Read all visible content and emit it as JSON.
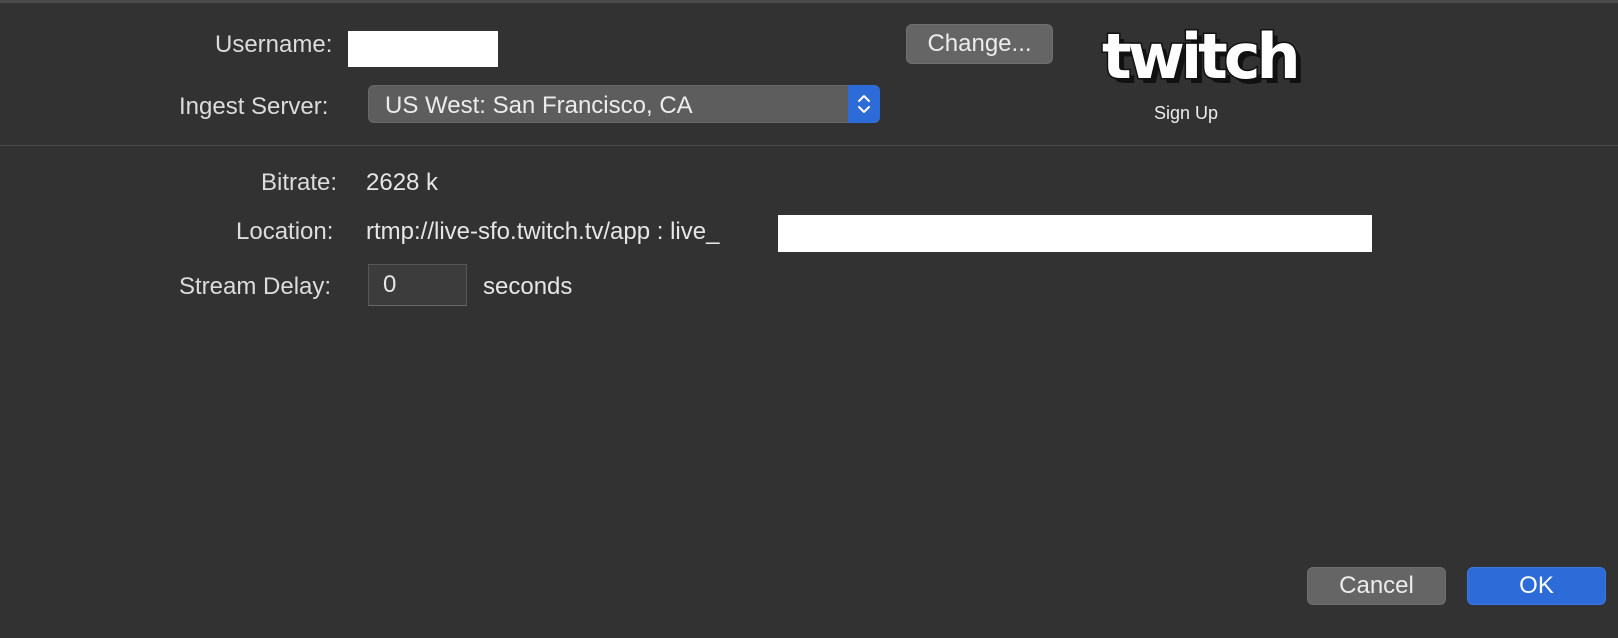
{
  "account": {
    "username_label": "Username:",
    "change_button": "Change...",
    "ingest_label": "Ingest Server:",
    "ingest_value": "US West: San Francisco, CA",
    "logo_text": "twitch",
    "signup_link": "Sign Up"
  },
  "stream": {
    "bitrate_label": "Bitrate:",
    "bitrate_value": "2628 k",
    "location_label": "Location:",
    "location_value": "rtmp://live-sfo.twitch.tv/app : live_",
    "delay_label": "Stream Delay:",
    "delay_value": "0",
    "delay_unit": "seconds"
  },
  "footer": {
    "cancel_button": "Cancel",
    "ok_button": "OK"
  },
  "colors": {
    "background": "#323232",
    "accent": "#2d6bd8",
    "button": "#656565"
  },
  "icons": {
    "select_arrows": "chevron-up-down-icon",
    "logo": "twitch-logo"
  }
}
